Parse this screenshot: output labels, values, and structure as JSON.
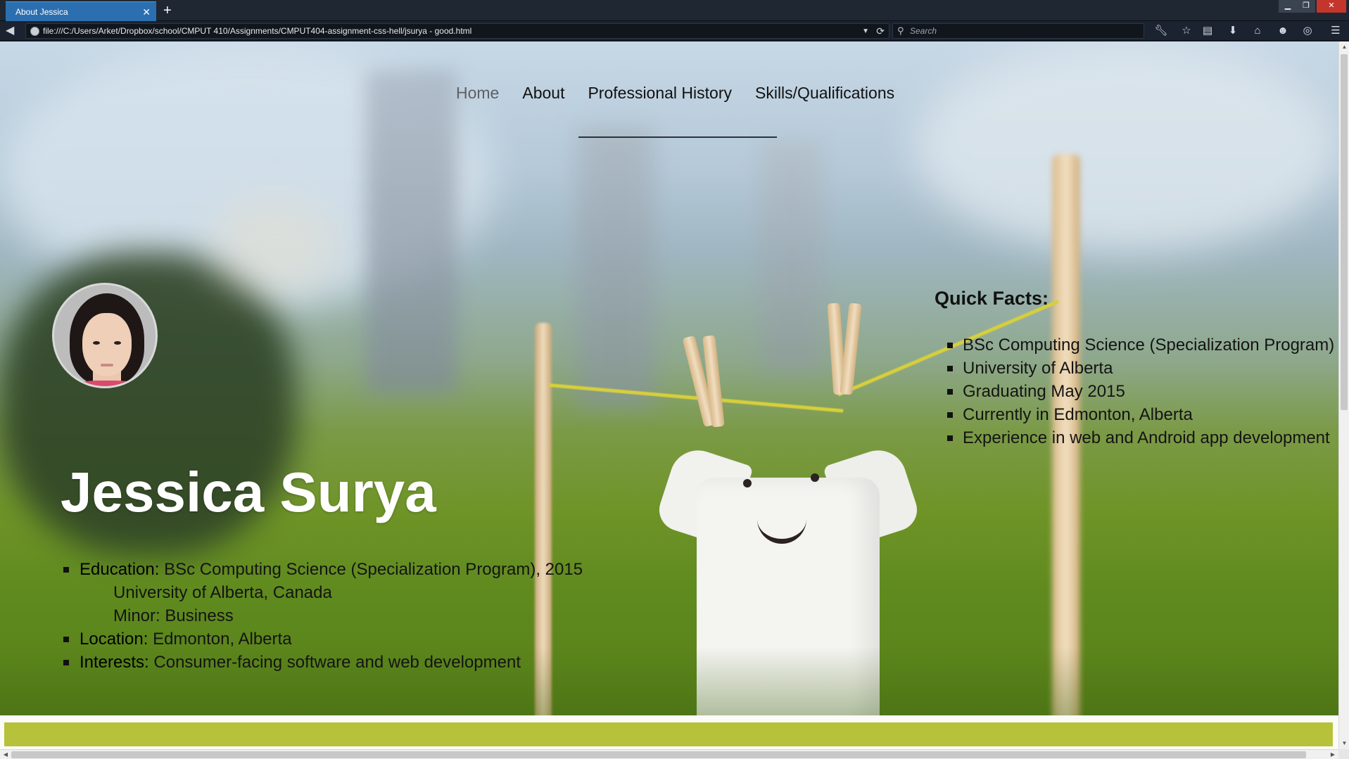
{
  "browser": {
    "tab_title": "About Jessica",
    "tab_close": "✕",
    "new_tab": "+",
    "url": "file:///C:/Users/Arket/Dropbox/school/CMPUT 410/Assignments/CMPUT404-assignment-css-hell/jsurya - good.html",
    "search_placeholder": "Search",
    "icons": [
      "back-icon",
      "globe-icon",
      "dropdown-icon",
      "reload-icon",
      "search-icon",
      "wrench-icon",
      "star-icon",
      "clipboard-icon",
      "download-icon",
      "home-icon",
      "chat-icon",
      "addon-icon",
      "menu-icon"
    ]
  },
  "page": {
    "nav": [
      {
        "label": "Home",
        "active": true
      },
      {
        "label": "About"
      },
      {
        "label": "Professional History"
      },
      {
        "label": "Skills/Qualifications"
      }
    ],
    "name": "Jessica Surya",
    "bio": {
      "education_label": "Education:",
      "education_value": " BSc Computing Science (Specialization Program), 2015",
      "education_line2": "University of Alberta, Canada",
      "education_line3": "Minor: Business",
      "location_label": "Location:",
      "location_value": " Edmonton, Alberta",
      "interests_label": "Interests:",
      "interests_value": " Consumer-facing software and web development"
    },
    "quick_facts": {
      "title": "Quick Facts:",
      "items": [
        "BSc Computing Science (Specialization Program)",
        "University of Alberta",
        "Graduating May 2015",
        "Currently in Edmonton, Alberta",
        "Experience in web and Android app development"
      ]
    }
  },
  "colors": {
    "tab_active": "#2b6fb0",
    "chrome_bg": "#1b2330",
    "footer_bar": "#b6c239"
  }
}
